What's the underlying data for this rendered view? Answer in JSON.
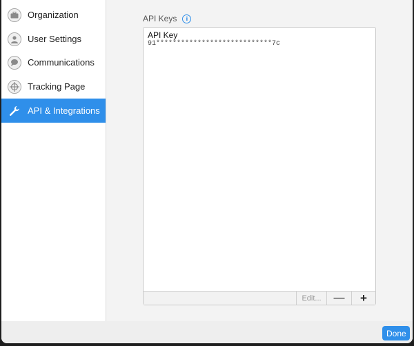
{
  "sidebar": {
    "items": [
      {
        "label": "Organization",
        "icon": "briefcase-icon"
      },
      {
        "label": "User Settings",
        "icon": "user-icon"
      },
      {
        "label": "Communications",
        "icon": "chat-bubble-icon"
      },
      {
        "label": "Tracking Page",
        "icon": "crosshair-icon"
      },
      {
        "label": "API & Integrations",
        "icon": "wrench-icon",
        "active": true
      }
    ]
  },
  "main": {
    "section_title": "API Keys",
    "info_glyph": "i",
    "keys": [
      {
        "name": "API Key",
        "value": "91****************************7c"
      }
    ],
    "footer": {
      "edit_label": "Edit...",
      "remove_label": "—",
      "add_label": "+"
    }
  },
  "bottom_bar": {
    "done_label": "Done"
  },
  "colors": {
    "accent": "#2f8fea"
  }
}
